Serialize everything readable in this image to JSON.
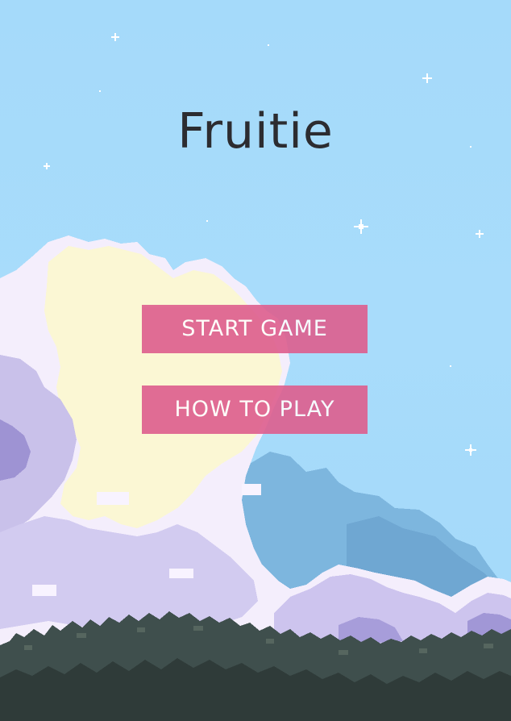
{
  "game": {
    "title": "Fruitie"
  },
  "menu": {
    "start_label": "START GAME",
    "how_label": "HOW TO PLAY"
  },
  "colors": {
    "sky": "#A6DBFA",
    "button": "#DE5E8E",
    "title_text": "#2C2C30",
    "button_text": "#FFFFFF",
    "cloud_white": "#F4EEFC",
    "cloud_cream": "#FBF7D4",
    "cloud_lavender": "#C8BFEA",
    "cloud_purple": "#9D92D2",
    "cloud_blue": "#7CB5DD",
    "forest": "#3F4F4D",
    "forest_dark": "#2E3A38"
  },
  "icons": {
    "stars": "sparkle-star-icon"
  }
}
